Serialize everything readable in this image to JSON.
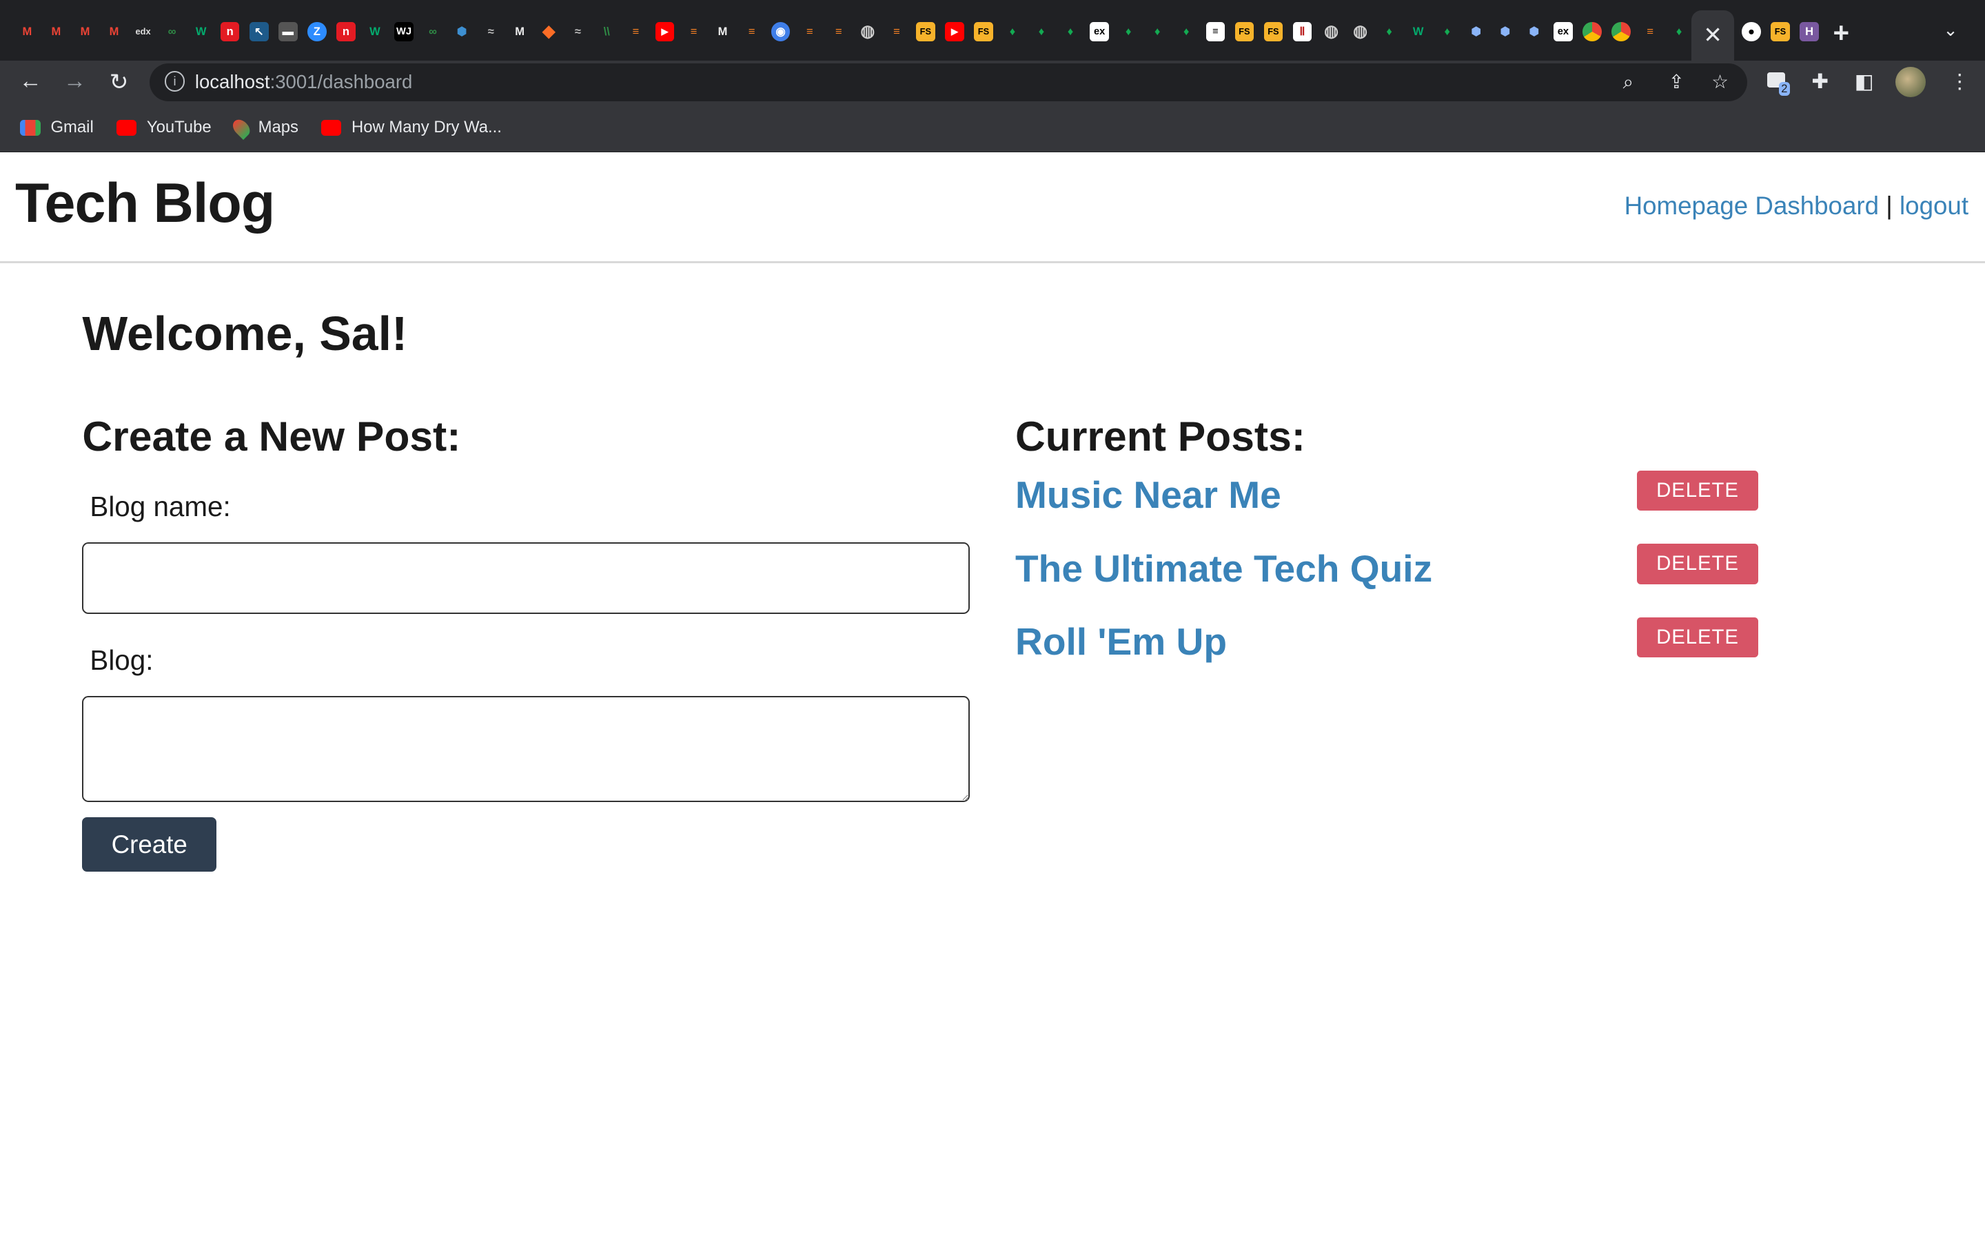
{
  "browser": {
    "url_host": "localhost",
    "url_path": ":3001/dashboard",
    "extension_badge": "2",
    "bookmarks": [
      {
        "label": "Gmail",
        "icon": "gmail-icon",
        "color": "#ea4335"
      },
      {
        "label": "YouTube",
        "icon": "youtube-icon",
        "color": "#ff0000"
      },
      {
        "label": "Maps",
        "icon": "maps-icon",
        "color": "#34a853"
      },
      {
        "label": "How Many Dry Wa...",
        "icon": "youtube-icon",
        "color": "#ff0000"
      }
    ]
  },
  "site": {
    "title": "Tech Blog",
    "nav": {
      "homepage": "Homepage",
      "dashboard": "Dashboard",
      "separator": "|",
      "logout": "logout"
    }
  },
  "welcome": "Welcome, Sal!",
  "create_form": {
    "heading": "Create a New Post:",
    "name_label": "Blog name:",
    "name_value": "",
    "body_label": "Blog:",
    "body_value": "",
    "submit_label": "Create"
  },
  "posts": {
    "heading": "Current Posts:",
    "delete_label": "DELETE",
    "items": [
      {
        "title": "Music Near Me"
      },
      {
        "title": "The Ultimate Tech Quiz"
      },
      {
        "title": "Roll 'Em Up"
      }
    ]
  },
  "colors": {
    "link": "#3a83b8",
    "delete": "#d75466",
    "create": "#2f3e50"
  }
}
